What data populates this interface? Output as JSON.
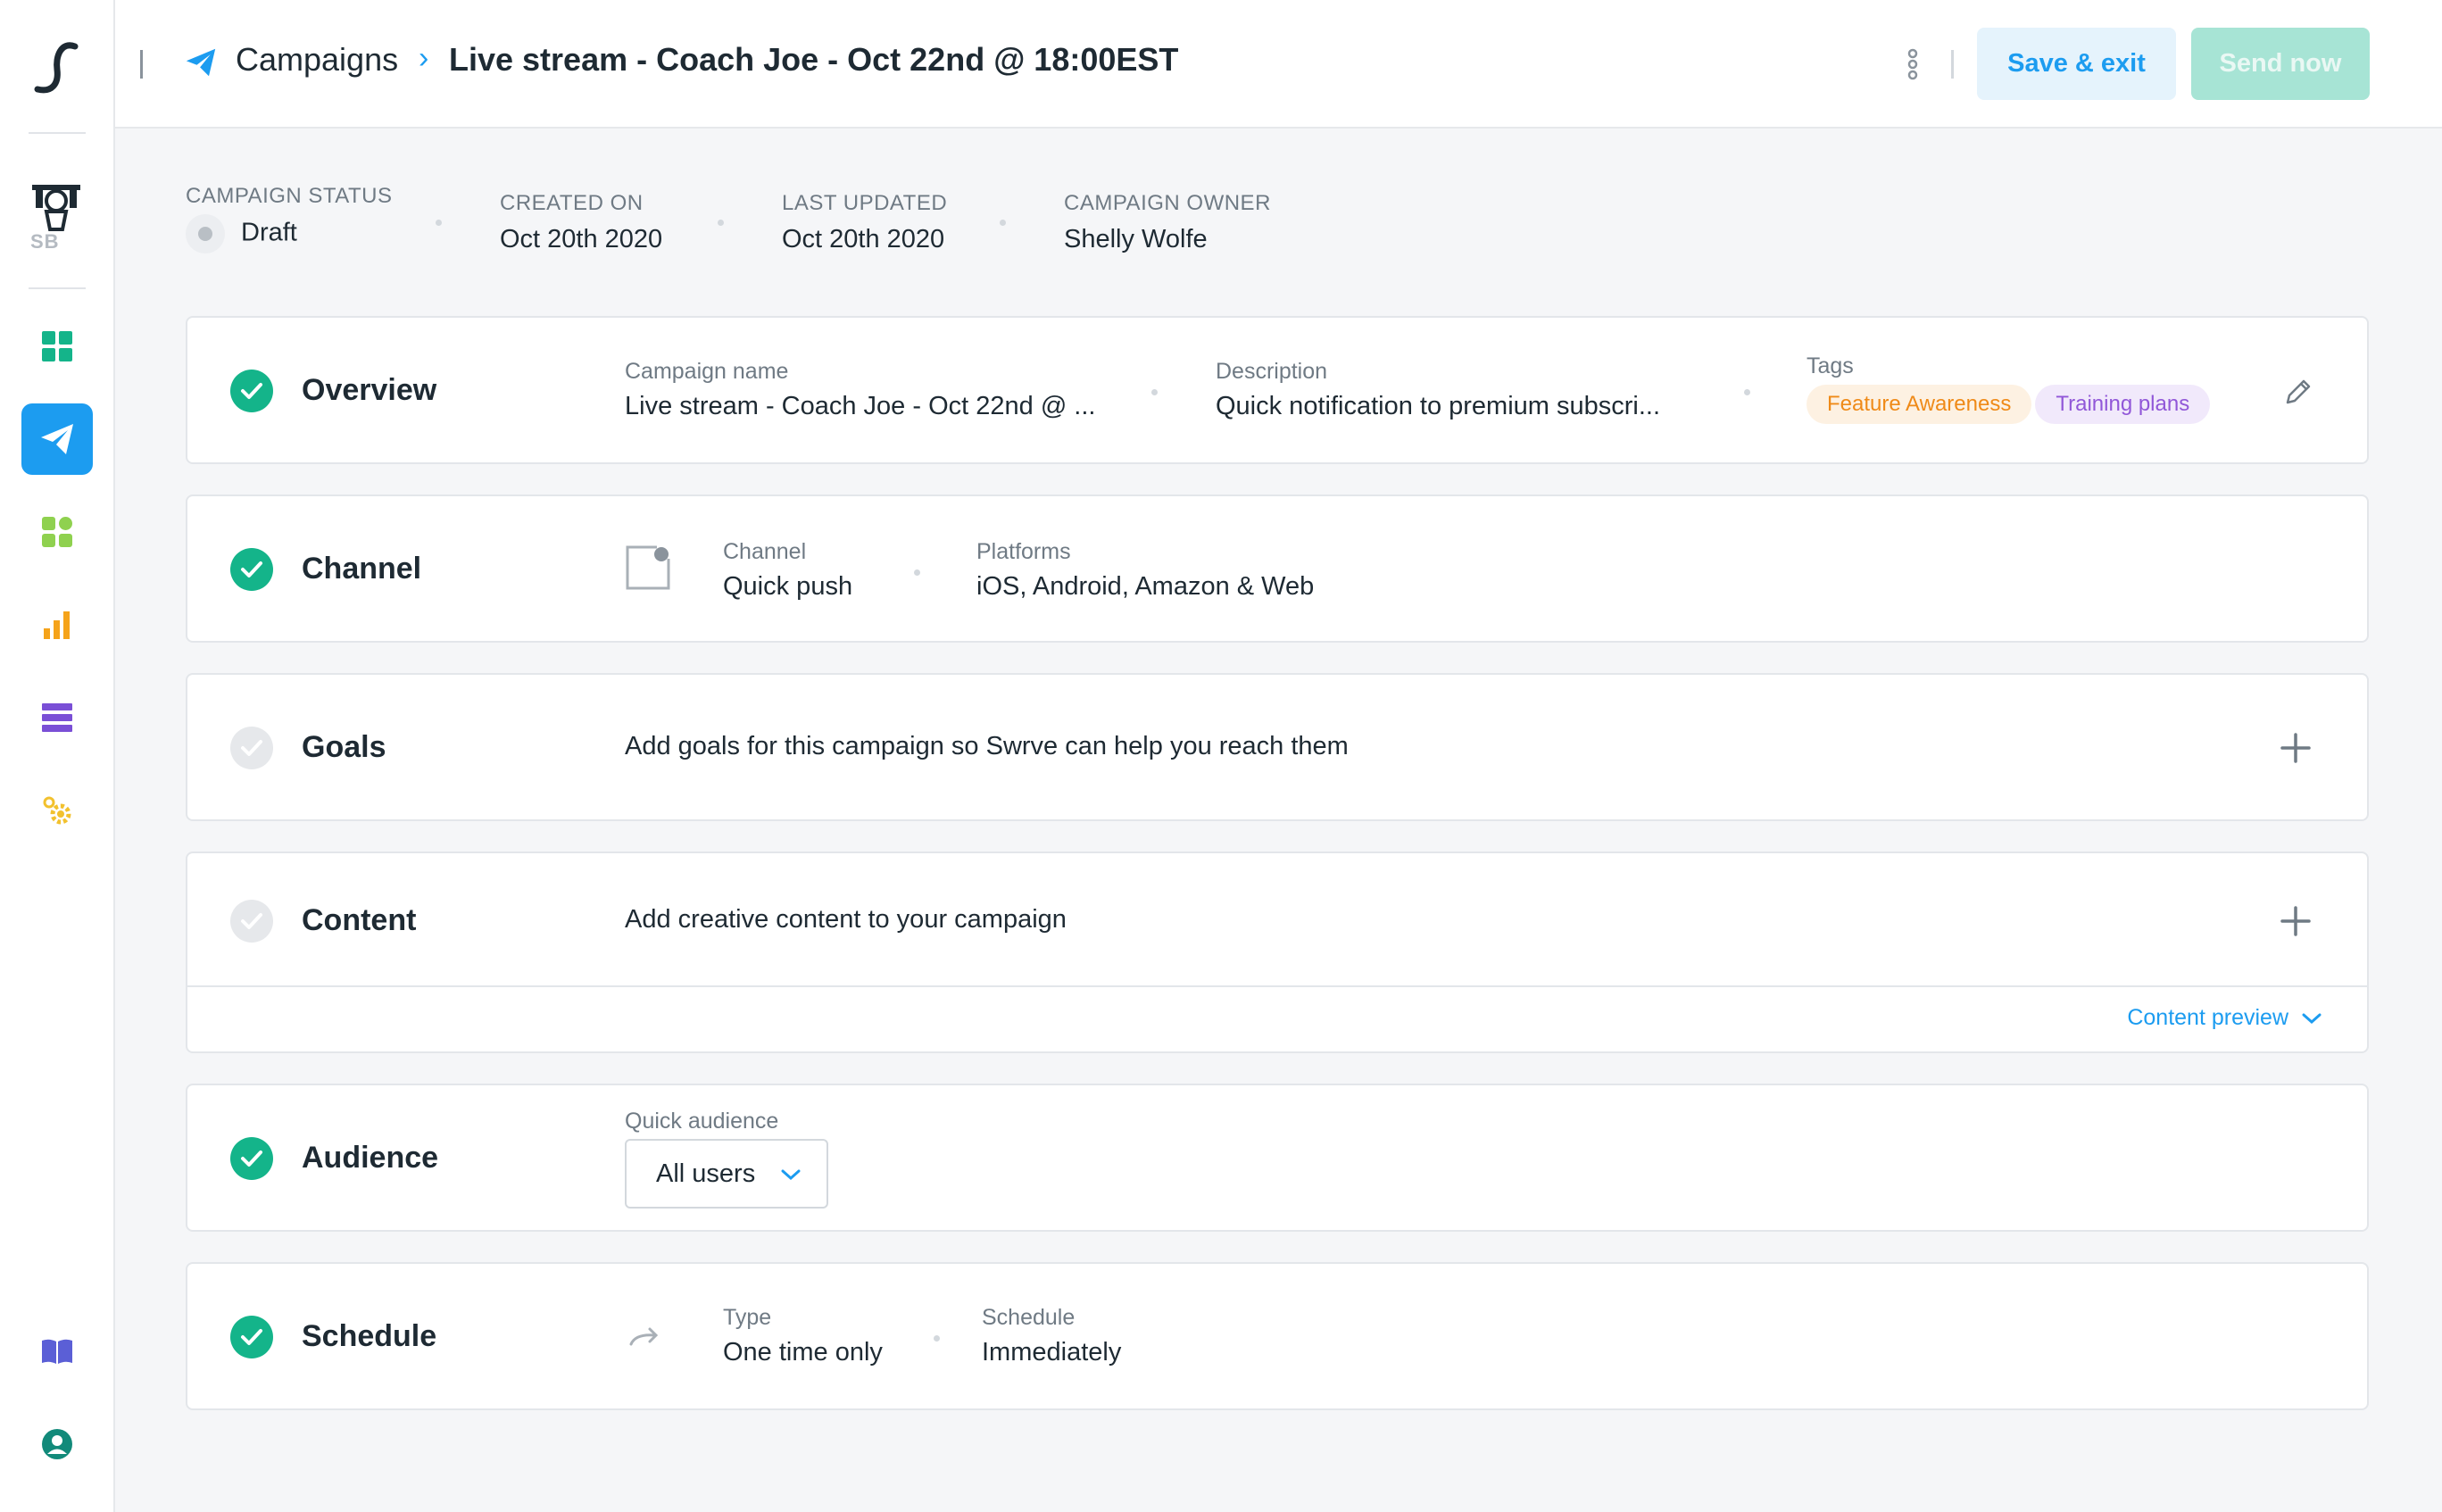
{
  "colors": {
    "accent": "#1c9cf0",
    "success": "#14b48a",
    "send_button_bg": "#a7e4d5",
    "tag_orange": "#ef8a18",
    "tag_purple": "#9157d8"
  },
  "sidebar": {
    "brand_label": "SB",
    "items": [
      {
        "icon": "dashboard-icon",
        "active": false
      },
      {
        "icon": "campaigns-icon",
        "active": true
      },
      {
        "icon": "widgets-icon",
        "active": false
      },
      {
        "icon": "analytics-icon",
        "active": false
      },
      {
        "icon": "data-icon",
        "active": false
      },
      {
        "icon": "settings-icon",
        "active": false
      }
    ],
    "bottom_items": [
      {
        "icon": "docs-icon"
      },
      {
        "icon": "user-icon"
      }
    ]
  },
  "header": {
    "breadcrumb_root": "Campaigns",
    "breadcrumb_sep": "›",
    "title": "Live stream - Coach Joe - Oct 22nd @ 18:00EST",
    "save_label": "Save & exit",
    "send_label": "Send now"
  },
  "meta": {
    "status_label": "CAMPAIGN STATUS",
    "status_value": "Draft",
    "created_label": "CREATED ON",
    "created_value": "Oct 20th 2020",
    "updated_label": "LAST UPDATED",
    "updated_value": "Oct 20th 2020",
    "owner_label": "CAMPAIGN OWNER",
    "owner_value": "Shelly Wolfe"
  },
  "overview": {
    "title": "Overview",
    "name_label": "Campaign name",
    "name_value": "Live stream - Coach Joe - Oct 22nd @ ...",
    "desc_label": "Description",
    "desc_value": "Quick notification to premium subscri...",
    "tags_label": "Tags",
    "tags": [
      "Feature Awareness",
      "Training plans"
    ]
  },
  "channel": {
    "title": "Channel",
    "channel_label": "Channel",
    "channel_value": "Quick push",
    "platforms_label": "Platforms",
    "platforms_value": "iOS, Android, Amazon & Web"
  },
  "goals": {
    "title": "Goals",
    "text": "Add goals for this campaign so Swrve can help you reach them"
  },
  "content": {
    "title": "Content",
    "text": "Add creative content to your campaign",
    "preview_label": "Content preview"
  },
  "audience": {
    "title": "Audience",
    "label": "Quick audience",
    "value": "All users"
  },
  "schedule": {
    "title": "Schedule",
    "type_label": "Type",
    "type_value": "One time only",
    "schedule_label": "Schedule",
    "schedule_value": "Immediately"
  }
}
